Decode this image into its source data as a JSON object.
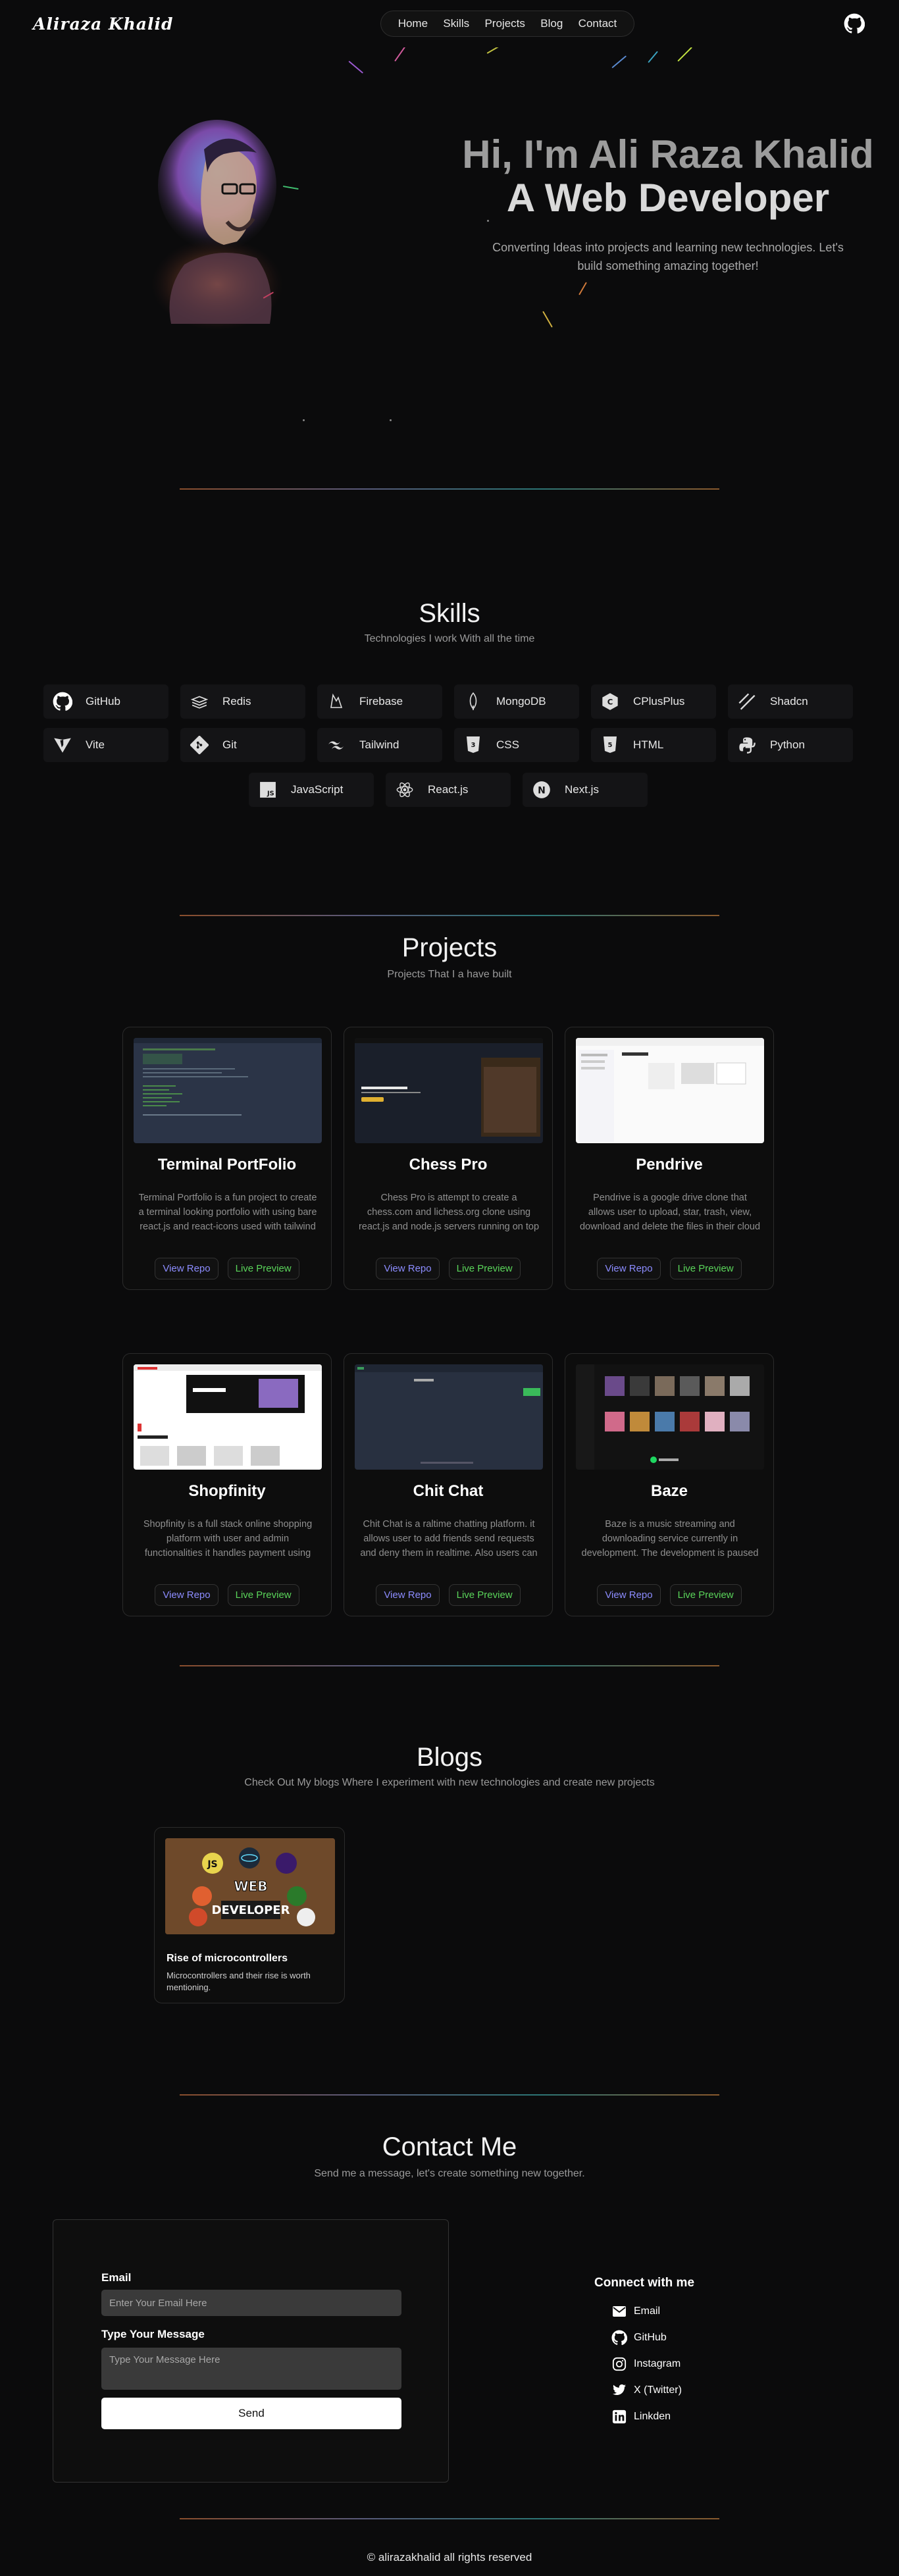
{
  "nav": {
    "logo": "Aliraza Khalid",
    "links": [
      "Home",
      "Skills",
      "Projects",
      "Blog",
      "Contact"
    ]
  },
  "hero": {
    "greeting": "Hi, I'm Ali Raza Khalid",
    "role": "A Web Developer",
    "tagline": "Converting Ideas into projects and learning new technologies. Let's build something amazing together!"
  },
  "skills": {
    "title": "Skills",
    "subtitle": "Technologies I work With all the time",
    "items": [
      {
        "label": "GitHub",
        "icon": "github-icon"
      },
      {
        "label": "Redis",
        "icon": "redis-icon"
      },
      {
        "label": "Firebase",
        "icon": "firebase-icon"
      },
      {
        "label": "MongoDB",
        "icon": "mongodb-icon"
      },
      {
        "label": "CPlusPlus",
        "icon": "cplusplus-icon"
      },
      {
        "label": "Shadcn",
        "icon": "shadcn-icon"
      },
      {
        "label": "Vite",
        "icon": "vite-icon"
      },
      {
        "label": "Git",
        "icon": "git-icon"
      },
      {
        "label": "Tailwind",
        "icon": "tailwind-icon"
      },
      {
        "label": "CSS",
        "icon": "css-icon"
      },
      {
        "label": "HTML",
        "icon": "html-icon"
      },
      {
        "label": "Python",
        "icon": "python-icon"
      },
      {
        "label": "JavaScript",
        "icon": "javascript-icon"
      },
      {
        "label": "React.js",
        "icon": "react-icon"
      },
      {
        "label": "Next.js",
        "icon": "nextjs-icon"
      }
    ]
  },
  "projects": {
    "title": "Projects",
    "subtitle": "Projects That I a have built",
    "repo_label": "View Repo",
    "live_label": "Live Preview",
    "items": [
      {
        "title": "Terminal PortFolio",
        "desc": "Terminal Portfolio is a fun project to create a terminal looking portfolio with using bare react.js and react-icons used with tailwind css",
        "thumb": "terminal"
      },
      {
        "title": "Chess Pro",
        "desc": "Chess Pro is attempt to create a chess.com and lichess.org clone using react.js and node.js servers running on top of web sock...",
        "thumb": "chess"
      },
      {
        "title": "Pendrive",
        "desc": "Pendrive is a google drive clone that allows user to upload, star, trash, view, download and delete the files in their cloud storage...",
        "thumb": "drive"
      },
      {
        "title": "Shopfinity",
        "desc": "Shopfinity is a full stack online shopping platform with user and admin functionalities it handles payment using stripe webbhooks an...",
        "thumb": "shop"
      },
      {
        "title": "Chit Chat",
        "desc": "Chit Chat is a raltime chatting platform. it allows user to add friends send requests and deny them in realtime. Also users can do...",
        "thumb": "chat"
      },
      {
        "title": "Baze",
        "desc": "Baze is a music streaming and downloading service currently in development. The development is paused becaue of the api...",
        "thumb": "music"
      }
    ]
  },
  "blogs": {
    "title": "Blogs",
    "subtitle": "Check Out My blogs Where I experiment with new technologies and create new projects",
    "items": [
      {
        "title": "Rise of microcontrollers",
        "desc": "Microcontrollers and their rise is worth mentioning.",
        "thumb_text": "WEB DEVELOPER"
      }
    ]
  },
  "contact": {
    "title": "Contact Me",
    "subtitle": "Send me a message, let's create something new together.",
    "email_label": "Email",
    "email_placeholder": "Enter Your Email Here",
    "message_label": "Type Your Message",
    "message_placeholder": "Type Your Message Here",
    "send_label": "Send",
    "connect_title": "Connect with me",
    "links": [
      {
        "label": "Email",
        "icon": "mail-icon"
      },
      {
        "label": "GitHub",
        "icon": "github-icon"
      },
      {
        "label": "Instagram",
        "icon": "instagram-icon"
      },
      {
        "label": "X (Twitter)",
        "icon": "twitter-icon"
      },
      {
        "label": "Linkden",
        "icon": "linkedin-icon"
      }
    ]
  },
  "footer": {
    "text": "© alirazakhalid all rights reserved"
  },
  "colors": {
    "background": "#0b0b0c",
    "repo_link": "#8c8cff",
    "live_link": "#5ad55a"
  }
}
